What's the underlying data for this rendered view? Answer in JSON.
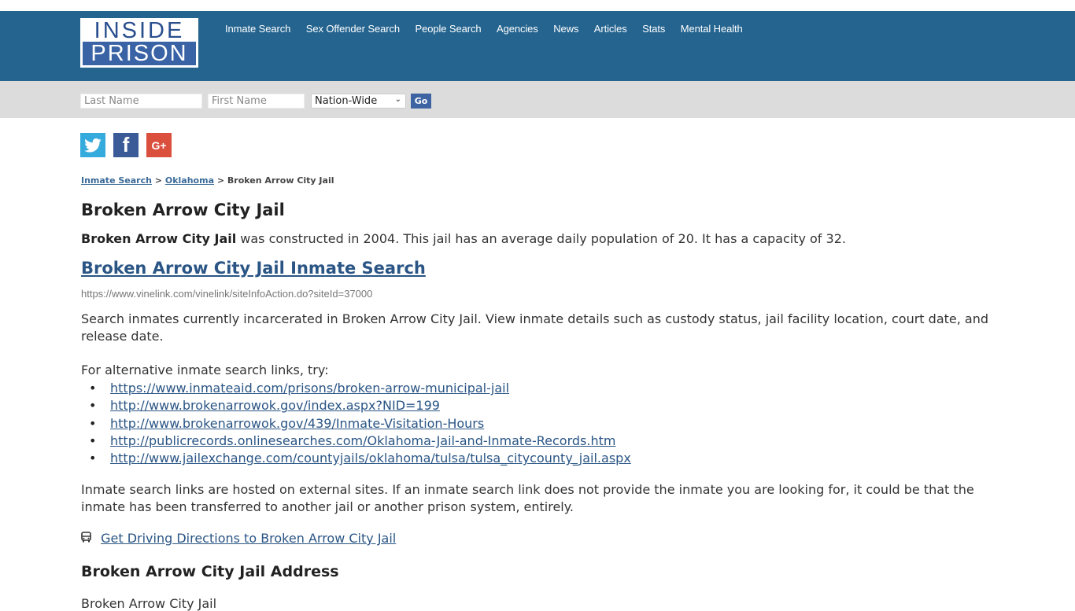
{
  "header": {
    "logo": {
      "top": "INSIDE",
      "bottom": "PRISON"
    },
    "nav": [
      "Inmate Search",
      "Sex Offender Search",
      "People Search",
      "Agencies",
      "News",
      "Articles",
      "Stats",
      "Mental Health"
    ]
  },
  "search": {
    "last_name_placeholder": "Last Name",
    "first_name_placeholder": "First Name",
    "scope_selected": "Nation-Wide",
    "go_label": "Go"
  },
  "social": {
    "twitter": "twitter-icon",
    "facebook_glyph": "f",
    "googleplus_glyph": "G+"
  },
  "breadcrumb": {
    "items": [
      "Inmate Search",
      "Oklahoma"
    ],
    "separator": ">",
    "current": "Broken Arrow City Jail"
  },
  "page": {
    "title": "Broken Arrow City Jail",
    "intro_bold": "Broken Arrow City Jail",
    "intro_rest": " was constructed in 2004. This jail has an average daily population of 20. It has a capacity of 32.",
    "search_link": "Broken Arrow City Jail Inmate Search",
    "search_url": "https://www.vinelink.com/vinelink/siteInfoAction.do?siteId=37000",
    "description": "Search inmates currently incarcerated in Broken Arrow City Jail. View inmate details such as custody status, jail facility location, court date, and release date.",
    "alt_intro": "For alternative inmate search links, try:",
    "alt_links": [
      "https://www.inmateaid.com/prisons/broken-arrow-municipal-jail",
      "http://www.brokenarrowok.gov/index.aspx?NID=199",
      "http://www.brokenarrowok.gov/439/Inmate-Visitation-Hours",
      "http://publicrecords.onlinesearches.com/Oklahoma-Jail-and-Inmate-Records.htm",
      "http://www.jailexchange.com/countyjails/oklahoma/tulsa/tulsa_citycounty_jail.aspx"
    ],
    "note": "Inmate search links are hosted on external sites. If an inmate search link does not provide the inmate you are looking for, it could be that the inmate has been transferred to another jail or another prison system, entirely.",
    "directions_link": "Get Driving Directions to Broken Arrow City Jail",
    "address_heading": "Broken Arrow City Jail Address",
    "address_line1": "Broken Arrow City Jail"
  }
}
